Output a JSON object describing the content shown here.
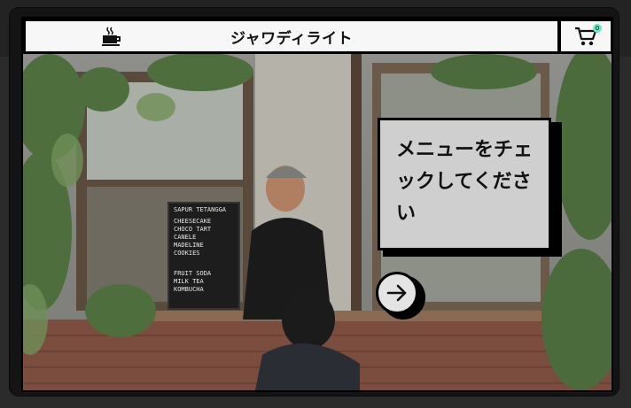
{
  "header": {
    "title": "ジャワディライト",
    "logo_icon": "coffee-cup-icon",
    "cart_icon": "cart-icon",
    "cart_count": "0",
    "badge_color": "#6ee7c8"
  },
  "hero": {
    "message": "メニューをチェックしてください",
    "cta_icon": "arrow-right-icon",
    "menu_board": {
      "heading": "SAPUR TETANGGA",
      "items": [
        "CHEESECAKE",
        "CHOCO TART",
        "CANELE",
        "MADELINE",
        "COOKIES",
        "FRUIT SODA",
        "MILK TEA",
        "KOMBUCHA"
      ]
    }
  }
}
